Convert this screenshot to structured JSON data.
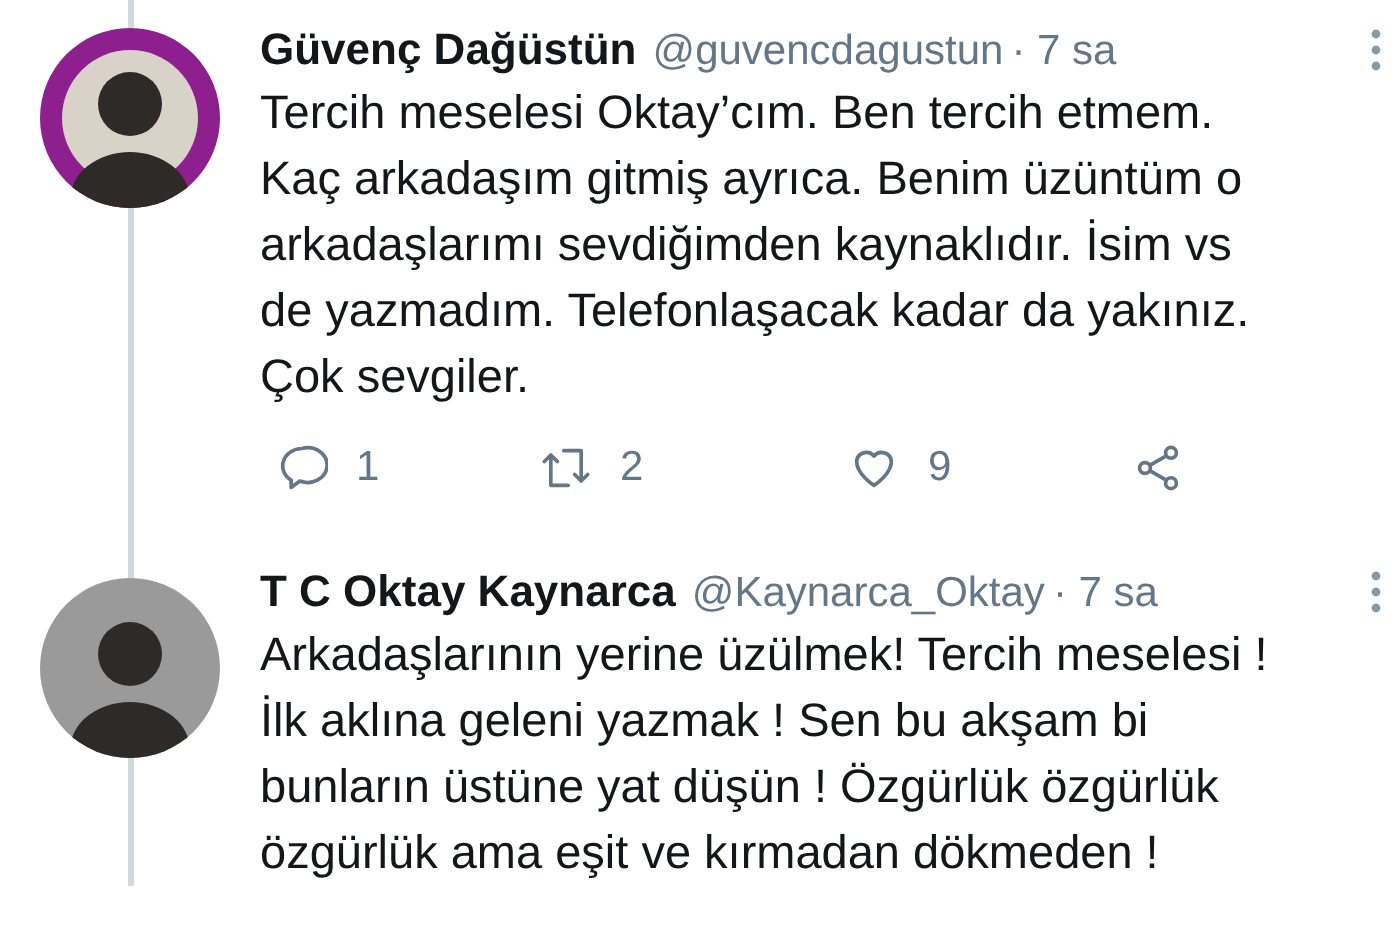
{
  "tweets": [
    {
      "name": "Güvenç Dağüstün",
      "handle": "@guvencdagustun",
      "time": "· 7 sa",
      "avatar": {
        "color": "#8e1f8f"
      },
      "body": "Tercih meselesi Oktay’cım. Ben tercih etmem.\nKaç arkadaşım gitmiş ayrıca. Benim üzüntüm o\narkadaşlarımı sevdiğimden kaynaklıdır. İsim vs\nde yazmadım. Telefonlaşacak kadar da yakınız.\nÇok sevgiler.",
      "actions": [
        {
          "kind": "reply",
          "count": "1"
        },
        {
          "kind": "retweet",
          "count": "2"
        },
        {
          "kind": "like",
          "count": "9"
        },
        {
          "kind": "share"
        }
      ]
    },
    {
      "name": "T C Oktay Kaynarca",
      "handle": "@Kaynarca_Oktay",
      "time": "· 7 sa",
      "avatar": {
        "color": "#9a9a9a"
      },
      "body": "Arkadaşlarının yerine üzülmek! Tercih meselesi !\nİlk aklına geleni yazmak ! Sen bu akşam bi\nbunların üstüne yat düşün ! Özgürlük özgürlük\nözgürlük  ama eşit ve kırmadan dökmeden !"
    }
  ]
}
